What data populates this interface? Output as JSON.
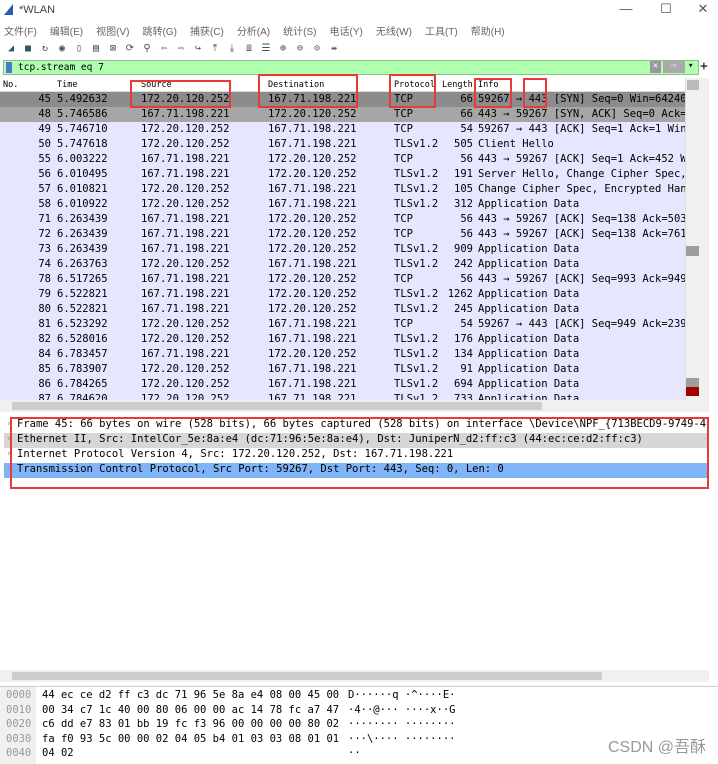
{
  "window": {
    "title": "*WLAN",
    "controls": [
      "—",
      "☐",
      "✕"
    ]
  },
  "menu": [
    "文件(F)",
    "编辑(E)",
    "视图(V)",
    "跳转(G)",
    "捕获(C)",
    "分析(A)",
    "统计(S)",
    "电话(Y)",
    "无线(W)",
    "工具(T)",
    "帮助(H)"
  ],
  "toolbar_icons": [
    "shark-fin-start",
    "stop",
    "restart",
    "options",
    "open",
    "save",
    "close",
    "reload",
    "find",
    "back",
    "forward",
    "goto",
    "first",
    "last",
    "autoscroll",
    "colorize",
    "zoom-in",
    "zoom-out",
    "zoom-reset",
    "resize-columns"
  ],
  "filter": {
    "value": "tcp.stream eq 7",
    "clear": "✕",
    "apply": "⇨",
    "dropdown": "▾",
    "add": "+"
  },
  "columns": [
    "No.",
    "Time",
    "Source",
    "Destination",
    "Protocol",
    "Length",
    "Info"
  ],
  "packets": [
    [
      "45",
      "5.492632",
      "172.20.120.252",
      "167.71.198.221",
      "TCP",
      "66",
      "59267 → 443 [SYN] Seq=0 Win=64240 L"
    ],
    [
      "48",
      "5.746586",
      "167.71.198.221",
      "172.20.120.252",
      "TCP",
      "66",
      "443 → 59267 [SYN, ACK] Seq=0 Ack=1"
    ],
    [
      "49",
      "5.746710",
      "172.20.120.252",
      "167.71.198.221",
      "TCP",
      "54",
      "59267 → 443 [ACK] Seq=1 Ack=1 Win=1"
    ],
    [
      "50",
      "5.747618",
      "172.20.120.252",
      "167.71.198.221",
      "TLSv1.2",
      "505",
      "Client Hello"
    ],
    [
      "55",
      "6.003222",
      "167.71.198.221",
      "172.20.120.252",
      "TCP",
      "56",
      "443 → 59267 [ACK] Seq=1 Ack=452 Win"
    ],
    [
      "56",
      "6.010495",
      "167.71.198.221",
      "172.20.120.252",
      "TLSv1.2",
      "191",
      "Server Hello, Change Cipher Spec, E"
    ],
    [
      "57",
      "6.010821",
      "172.20.120.252",
      "167.71.198.221",
      "TLSv1.2",
      "105",
      "Change Cipher Spec, Encrypted Hands"
    ],
    [
      "58",
      "6.010922",
      "172.20.120.252",
      "167.71.198.221",
      "TLSv1.2",
      "312",
      "Application Data"
    ],
    [
      "71",
      "6.263439",
      "167.71.198.221",
      "172.20.120.252",
      "TCP",
      "56",
      "443 → 59267 [ACK] Seq=138 Ack=503 W"
    ],
    [
      "72",
      "6.263439",
      "167.71.198.221",
      "172.20.120.252",
      "TCP",
      "56",
      "443 → 59267 [ACK] Seq=138 Ack=761 W"
    ],
    [
      "73",
      "6.263439",
      "167.71.198.221",
      "172.20.120.252",
      "TLSv1.2",
      "909",
      "Application Data"
    ],
    [
      "74",
      "6.263763",
      "172.20.120.252",
      "167.71.198.221",
      "TLSv1.2",
      "242",
      "Application Data"
    ],
    [
      "78",
      "6.517265",
      "167.71.198.221",
      "172.20.120.252",
      "TCP",
      "56",
      "443 → 59267 [ACK] Seq=993 Ack=949 W"
    ],
    [
      "79",
      "6.522821",
      "167.71.198.221",
      "172.20.120.252",
      "TLSv1.2",
      "1262",
      "Application Data"
    ],
    [
      "80",
      "6.522821",
      "167.71.198.221",
      "172.20.120.252",
      "TLSv1.2",
      "245",
      "Application Data"
    ],
    [
      "81",
      "6.523292",
      "172.20.120.252",
      "167.71.198.221",
      "TCP",
      "54",
      "59267 → 443 [ACK] Seq=949 Ack=2392"
    ],
    [
      "82",
      "6.528016",
      "172.20.120.252",
      "167.71.198.221",
      "TLSv1.2",
      "176",
      "Application Data"
    ],
    [
      "84",
      "6.783457",
      "167.71.198.221",
      "172.20.120.252",
      "TLSv1.2",
      "134",
      "Application Data"
    ],
    [
      "85",
      "6.783907",
      "172.20.120.252",
      "167.71.198.221",
      "TLSv1.2",
      "91",
      "Application Data"
    ],
    [
      "86",
      "6.784265",
      "172.20.120.252",
      "167.71.198.221",
      "TLSv1.2",
      "694",
      "Application Data"
    ],
    [
      "87",
      "6.784620",
      "172.20.120.252",
      "167.71.198.221",
      "TLSv1.2",
      "733",
      "Application Data"
    ]
  ],
  "details": [
    "Frame 45: 66 bytes on wire (528 bits), 66 bytes captured (528 bits) on interface \\Device\\NPF_{713BECD9-9749-4EA8-94B1",
    "Ethernet II, Src: IntelCor_5e:8a:e4 (dc:71:96:5e:8a:e4), Dst: JuniperN_d2:ff:c3 (44:ec:ce:d2:ff:c3)",
    "Internet Protocol Version 4, Src: 172.20.120.252, Dst: 167.71.198.221",
    "Transmission Control Protocol, Src Port: 59267, Dst Port: 443, Seq: 0, Len: 0"
  ],
  "hex": [
    [
      "0000",
      "44 ec ce d2 ff c3 dc 71  96 5e 8a e4 08 00 45 00",
      "D······q ·^····E·"
    ],
    [
      "0010",
      "00 34 c7 1c 40 00 80 06  00 00 ac 14 78 fc a7 47",
      "·4··@··· ····x··G"
    ],
    [
      "0020",
      "c6 dd e7 83 01 bb 19 fc  f3 96 00 00 00 00 80 02",
      "········ ········"
    ],
    [
      "0030",
      "fa f0 93 5c 00 00 02 04  05 b4 01 03 03 08 01 01",
      "···\\···· ········"
    ],
    [
      "0040",
      "04 02",
      "··"
    ]
  ],
  "watermark": "CSDN @吾酥",
  "colors": {
    "row_bg": "#e7e6ff",
    "selected_row": "#8c8c8c",
    "filter_bg": "#afffaf",
    "detail_selected": "#80b4f8",
    "highlight_box": "#e83a3a"
  }
}
